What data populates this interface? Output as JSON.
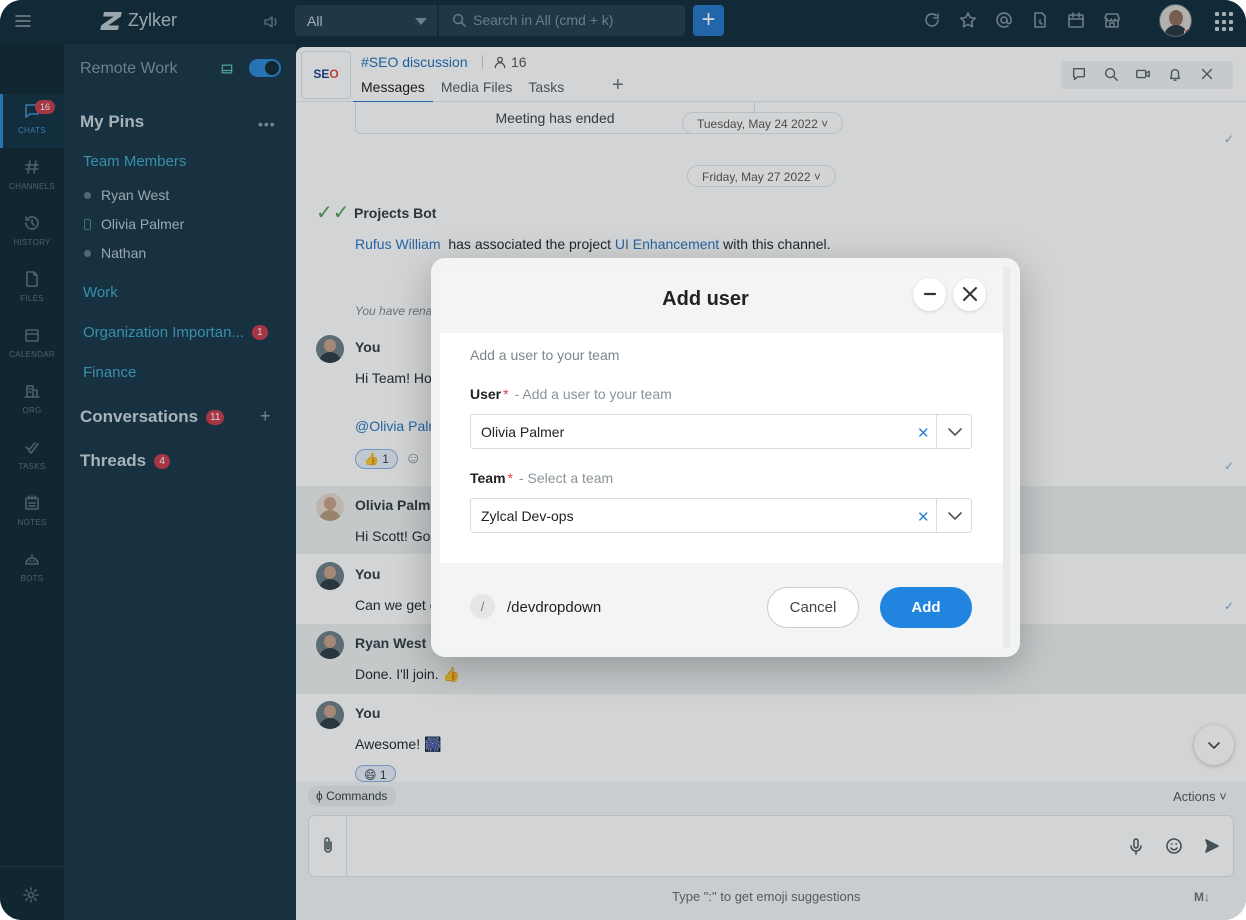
{
  "topbar": {
    "brand": "Zylker",
    "scope_select": "All",
    "search_placeholder": "Search in All (cmd + k)",
    "add_label": "+"
  },
  "rail": {
    "items": [
      {
        "label": "CHATS",
        "icon": "chat-icon",
        "badge": "16"
      },
      {
        "label": "CHANNELS",
        "icon": "hash-icon"
      },
      {
        "label": "HISTORY",
        "icon": "history-icon"
      },
      {
        "label": "FILES",
        "icon": "file-icon"
      },
      {
        "label": "CALENDAR",
        "icon": "calendar-icon"
      },
      {
        "label": "ORG",
        "icon": "org-icon"
      },
      {
        "label": "TASKS",
        "icon": "tasks-icon"
      },
      {
        "label": "NOTES",
        "icon": "notes-icon"
      },
      {
        "label": "BOTS",
        "icon": "bot-icon"
      }
    ]
  },
  "panel": {
    "workspace": "Remote Work",
    "my_pins": "My Pins",
    "team_members": "Team Members",
    "members": [
      "Ryan West",
      "Olivia Palmer",
      "Nathan"
    ],
    "work": "Work",
    "org_important": "Organization Importan...",
    "org_important_badge": "1",
    "finance": "Finance",
    "conversations": "Conversations",
    "conversations_badge": "11",
    "threads": "Threads",
    "threads_badge": "4"
  },
  "channel": {
    "logo_text_a": "SE",
    "logo_text_b": "O",
    "name": "#SEO discussion",
    "members": "16",
    "tabs": [
      "Messages",
      "Media Files",
      "Tasks"
    ]
  },
  "messages": {
    "meeting_ended": "Meeting has ended",
    "date1": "Tuesday, May 24 2022",
    "date2": "Friday, May 27 2022",
    "bot_name": "Projects Bot",
    "bot_user": "Rufus William",
    "bot_text_a": "has associated the project",
    "bot_project": "UI Enhancement",
    "bot_text_b": "with this channel.",
    "sys_note": "You have rena",
    "m1_sender": "You",
    "m1_text": "Hi Team! Hov",
    "m1_mention": "@Olivia Palm",
    "m1_reaction": "👍 1",
    "m2_sender": "Olivia Palme",
    "m2_text": "Hi Scott! Goo",
    "m3_sender": "You",
    "m3_text": "Can we get o",
    "m4_sender": "Ryan West",
    "m4_text": "Done. I'll join. 👍",
    "m5_sender": "You",
    "m5_text": "Awesome! 🎆",
    "m5_reaction": "😄 1"
  },
  "composer": {
    "commands": "Commands",
    "actions": "Actions",
    "hint": "Type \":\" to get emoji suggestions",
    "markdown": "M↓"
  },
  "modal": {
    "title": "Add user",
    "subtitle": "Add a user to your team",
    "user_label": "User",
    "user_hint": "- Add a user to your team",
    "user_value": "Olivia Palmer",
    "team_label": "Team",
    "team_hint": "- Select a team",
    "team_value": "Zylcal Dev-ops",
    "command": "/devdropdown",
    "slash": "/",
    "cancel": "Cancel",
    "add": "Add"
  }
}
